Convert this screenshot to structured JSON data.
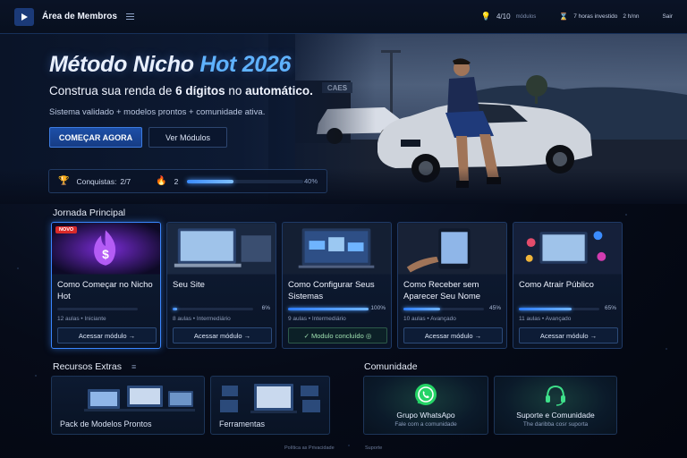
{
  "topbar": {
    "brand": "Área de Membros",
    "progress": "4/10",
    "progress_label": "módulos",
    "time": "7 horas investido",
    "time_extra": "2 h/nn",
    "logout": "Sair"
  },
  "hero": {
    "title_main": "Método Nicho ",
    "title_accent": "Hot 2026",
    "subtitle_pre": "Construa sua renda de ",
    "subtitle_bold": "6 dígitos",
    "subtitle_post": " no ",
    "subtitle_bold2": "automático.",
    "description": "Sistema validado + modelos prontos + comunidade ativa.",
    "primary_button": "COMEÇAR AGORA",
    "secondary_button": "Ver Módulos",
    "store_sign": "CAES"
  },
  "achievements": {
    "label": "Conquistas:",
    "value": "2/7",
    "streak": "2",
    "percent_text": "40%",
    "progress": 0.4
  },
  "journey": {
    "title": "Jornada Principal",
    "cards": [
      {
        "badge": "NOVO",
        "title": "Como Começar no Nicho Hot",
        "meta_top": "",
        "percent": 0.0,
        "percent_text": "",
        "meta": "12 aulas • Iniciante",
        "button": "Acessar módulo →",
        "done": false
      },
      {
        "badge": "",
        "title": "Seu Site",
        "meta_top": "8 aulas • Intermediário",
        "percent": 0.06,
        "percent_text": "6%",
        "meta": "8 aulas • Intermediário",
        "button": "Acessar módulo →",
        "done": false
      },
      {
        "badge": "",
        "title": "Como Configurar Seus Sistemas",
        "meta_top": "",
        "percent": 1.0,
        "percent_text": "100%",
        "meta": "9 aulas • Intermediário",
        "button": "✓ Modulo concluído ◎",
        "done": true
      },
      {
        "badge": "",
        "title": "Como Receber sem Aparecer Seu Nome",
        "meta_top": "",
        "percent": 0.45,
        "percent_text": "45%",
        "meta": "10 aulas • Avançado",
        "button": "Acessar módulo →",
        "done": false
      },
      {
        "badge": "",
        "title": "Como Atrair Público",
        "meta_top": "11 aulas • Avançado",
        "percent": 0.65,
        "percent_text": "65%",
        "meta": "11 aulas • Avançado",
        "button": "Acessar módulo →",
        "done": false
      }
    ]
  },
  "resources": {
    "title": "Recursos Extras",
    "items": [
      "Pack de Modelos Prontos",
      "Ferramentas"
    ]
  },
  "community": {
    "title": "Comunidade",
    "items": [
      {
        "label": "Grupo WhatsApo",
        "sub": "Fale com a comunidade",
        "icon": "whatsapp-icon"
      },
      {
        "label": "Suporte e Comunidade",
        "sub": "The daribba cosr suporta",
        "icon": "headset-icon"
      }
    ]
  },
  "footer": {
    "privacy": "Política as Privacidade",
    "support": "Suporte"
  },
  "colors": {
    "accent": "#3a86ff",
    "brand": "#1b3a78",
    "badge": "#d92a2a",
    "whatsapp": "#25d366"
  }
}
